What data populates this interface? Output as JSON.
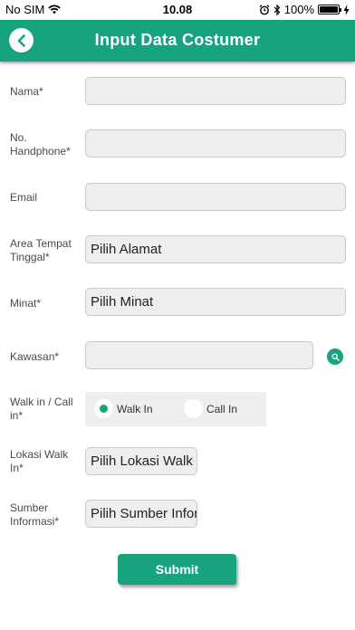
{
  "status_bar": {
    "carrier": "No SIM",
    "time": "10.08",
    "battery": "100%"
  },
  "header": {
    "title": "Input Data Costumer"
  },
  "form": {
    "nama": {
      "label": "Nama*",
      "value": ""
    },
    "handphone": {
      "label": "No. Handphone*",
      "value": ""
    },
    "email": {
      "label": "Email",
      "value": ""
    },
    "area": {
      "label": "Area Tempat Tinggal*",
      "value": "Pilih Alamat"
    },
    "minat": {
      "label": "Minat*",
      "value": "Pilih Minat"
    },
    "kawasan": {
      "label": "Kawasan*",
      "value": ""
    },
    "walkin": {
      "label": "Walk in / Call in*",
      "options": [
        "Walk In",
        "Call In"
      ],
      "selected": "Walk In"
    },
    "lokasi": {
      "label": "Lokasi Walk In*",
      "value": "Pilih Lokasi Walk In"
    },
    "sumber": {
      "label": "Sumber Informasi*",
      "value": "Pilih Sumber Informasi"
    }
  },
  "submit_label": "Submit",
  "colors": {
    "accent": "#16a37d",
    "field_bg": "#eeeeee"
  }
}
